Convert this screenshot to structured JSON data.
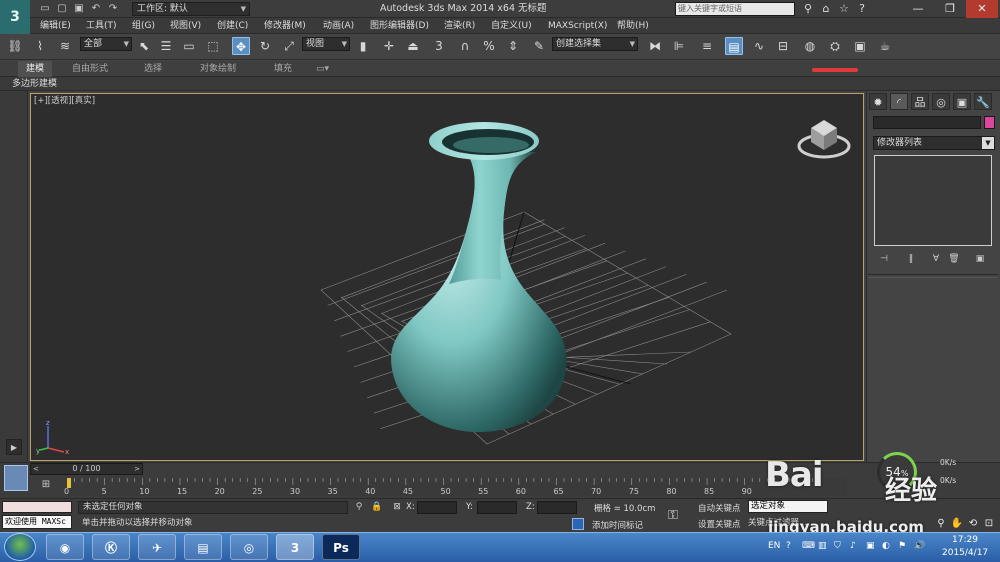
{
  "titlebar": {
    "workspace": "工作区: 默认",
    "title": "Autodesk 3ds Max  2014 x64      无标题",
    "search_placeholder": "键入关键字或短语"
  },
  "menu": [
    "编辑(E)",
    "工具(T)",
    "组(G)",
    "视图(V)",
    "创建(C)",
    "修改器(M)",
    "动画(A)",
    "图形编辑器(D)",
    "渲染(R)",
    "自定义(U)",
    "MAXScript(X)",
    "帮助(H)"
  ],
  "toolbar": {
    "selection_filter": "全部",
    "ref_coord": "视图",
    "snap_3": "3",
    "named_selection": "创建选择集"
  },
  "ribbon": {
    "tabs": [
      "建模",
      "自由形式",
      "选择",
      "对象绘制",
      "填充"
    ],
    "active_tab": "建模",
    "sub_tab": "多边形建模"
  },
  "viewport": {
    "label": "[+][透视][真实]",
    "axis_labels": {
      "x": "x",
      "y": "y",
      "z": "z"
    }
  },
  "command_panel": {
    "modifier_list": "修改器列表"
  },
  "timeline": {
    "frame_display": "0 / 100",
    "ticks": [
      "0",
      "5",
      "10",
      "15",
      "20",
      "25",
      "30",
      "35",
      "40",
      "45",
      "50",
      "55",
      "60",
      "65",
      "70",
      "75",
      "80",
      "85",
      "90"
    ]
  },
  "status": {
    "listener": "欢迎使用 MAXSc",
    "selection_info": "未选定任何对象",
    "prompt": "单击并拖动以选择并移动对象",
    "x_label": "X:",
    "y_label": "Y:",
    "z_label": "Z:",
    "grid": "栅格 = 10.0cm",
    "add_time_tag": "添加时间标记",
    "auto_key": "自动关键点",
    "set_key": "设置关键点",
    "selected_set": "选定对象",
    "key_filters": "关键点过滤器..."
  },
  "perf": {
    "percent": "54",
    "percent_suffix": "%",
    "up": "0K/s",
    "down": "0K/s"
  },
  "watermark": {
    "brand": "Bai",
    "product": "经验",
    "url": "jingyan.baidu.com"
  },
  "taskbar": {
    "apps": [
      "chrome",
      "kugou",
      "feiq",
      "explorer",
      "media",
      "3dsmax",
      "photoshop"
    ],
    "ps_label": "Ps",
    "lang": "EN",
    "time": "17:29",
    "date": "2015/4/17"
  },
  "colors": {
    "vase": "#7fc7c3",
    "viewport_border": "#b6a36a",
    "active_tool": "#5a8fbf",
    "object_color": "#d9479c"
  }
}
